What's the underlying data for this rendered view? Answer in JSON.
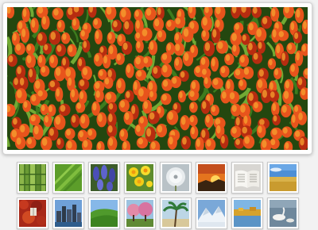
{
  "viewer": {
    "main_image": {
      "subject": "tulip-field-photo",
      "colors": {
        "petal": "#e8541c",
        "petal_light": "#f7a12f",
        "petal_dark": "#b72c10",
        "leaf": "#3d7c1e",
        "leaf_light": "#72aa34",
        "ground": "#24470f"
      }
    },
    "thumbnails": [
      {
        "subject": "bamboo-stalks-photo"
      },
      {
        "subject": "green-leaf-photo"
      },
      {
        "subject": "grape-hyacinths-photo"
      },
      {
        "subject": "daffodils-photo"
      },
      {
        "subject": "dandelion-seedhead-photo"
      },
      {
        "subject": "sunset-photo"
      },
      {
        "subject": "open-book-photo"
      },
      {
        "subject": "wheat-field-photo"
      },
      {
        "subject": "red-ivy-wall-photo"
      },
      {
        "subject": "city-skyline-photo"
      },
      {
        "subject": "grassy-hills-photo"
      },
      {
        "subject": "blossom-trees-photo"
      },
      {
        "subject": "palm-beach-photo"
      },
      {
        "subject": "snowy-mountains-photo"
      },
      {
        "subject": "autumn-lake-photo"
      },
      {
        "subject": "swans-on-water-photo"
      }
    ]
  }
}
